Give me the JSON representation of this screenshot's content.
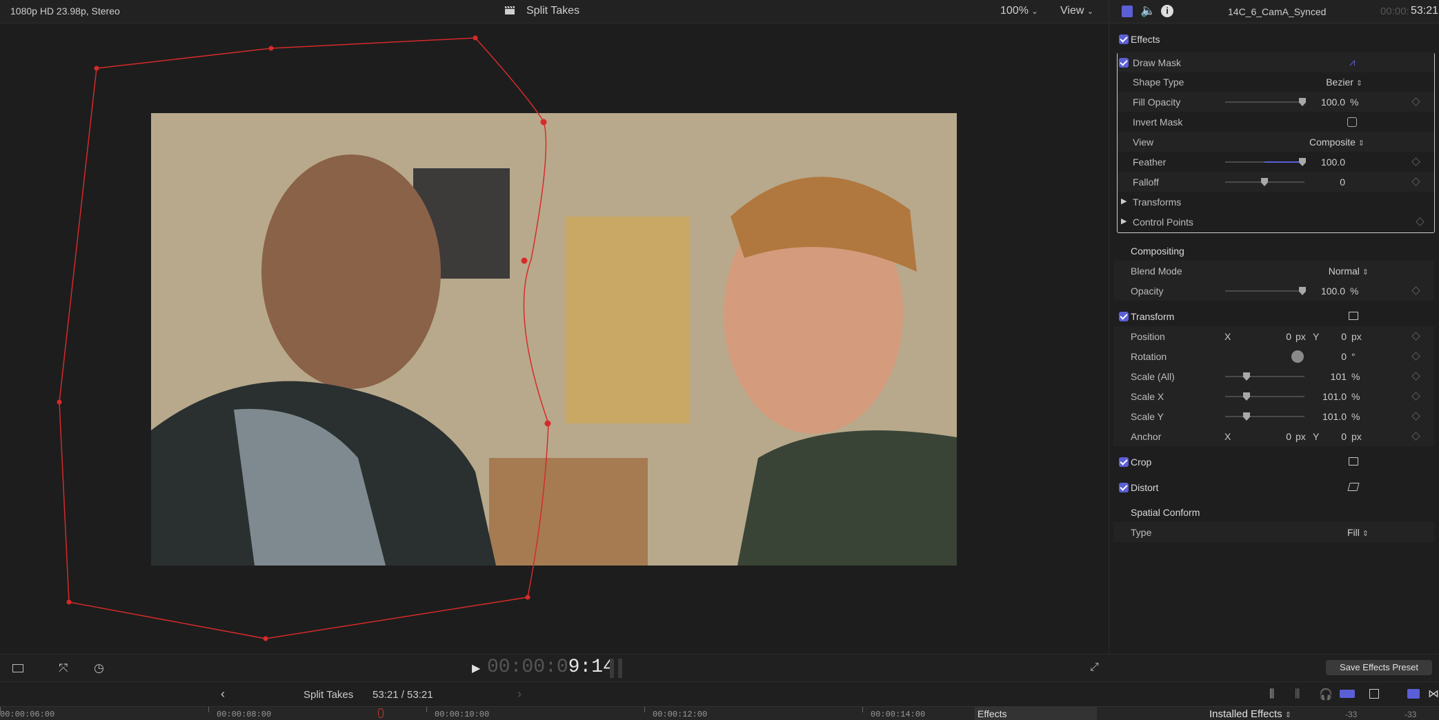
{
  "viewer": {
    "format": "1080p HD 23.98p, Stereo",
    "title": "Split Takes",
    "zoom": "100%",
    "view_menu": "View",
    "timecode_dim": "00:00:0",
    "timecode_bright": "9:14"
  },
  "inspector": {
    "clip_name": "14C_6_CamA_Synced",
    "duration_dim": "00:00:",
    "duration": "53:21",
    "effects_label": "Effects",
    "draw_mask": {
      "title": "Draw Mask",
      "shape_type_label": "Shape Type",
      "shape_type_value": "Bezier",
      "fill_opacity_label": "Fill Opacity",
      "fill_opacity_value": "100.0",
      "fill_opacity_unit": "%",
      "invert_mask_label": "Invert Mask",
      "view_label": "View",
      "view_value": "Composite",
      "feather_label": "Feather",
      "feather_value": "100.0",
      "falloff_label": "Falloff",
      "falloff_value": "0",
      "transforms_label": "Transforms",
      "control_points_label": "Control Points"
    },
    "compositing": {
      "title": "Compositing",
      "blend_mode_label": "Blend Mode",
      "blend_mode_value": "Normal",
      "opacity_label": "Opacity",
      "opacity_value": "100.0",
      "opacity_unit": "%"
    },
    "transform": {
      "title": "Transform",
      "position_label": "Position",
      "x_label": "X",
      "y_label": "Y",
      "position_x": "0",
      "position_y": "0",
      "px": "px",
      "rotation_label": "Rotation",
      "rotation_value": "0",
      "rotation_unit": "°",
      "scale_all_label": "Scale (All)",
      "scale_all_value": "101",
      "scale_x_label": "Scale X",
      "scale_x_value": "101.0",
      "scale_y_label": "Scale Y",
      "scale_y_value": "101.0",
      "pct": "%",
      "anchor_label": "Anchor",
      "anchor_x": "0",
      "anchor_y": "0"
    },
    "crop_label": "Crop",
    "distort_label": "Distort",
    "spatial_conform": {
      "title": "Spatial Conform",
      "type_label": "Type",
      "type_value": "Fill"
    },
    "save_preset_label": "Save Effects Preset"
  },
  "timeline": {
    "project_name": "Split Takes",
    "position": "53:21 / 53:21",
    "ruler": [
      "00:00:06:00",
      "00:00:08:00",
      "00:00:10:00",
      "00:00:12:00",
      "00:00:14:00"
    ],
    "effects_tab": "Effects",
    "installed_effects": "Installed Effects",
    "meter_left": "-33",
    "meter_right": "-33"
  }
}
